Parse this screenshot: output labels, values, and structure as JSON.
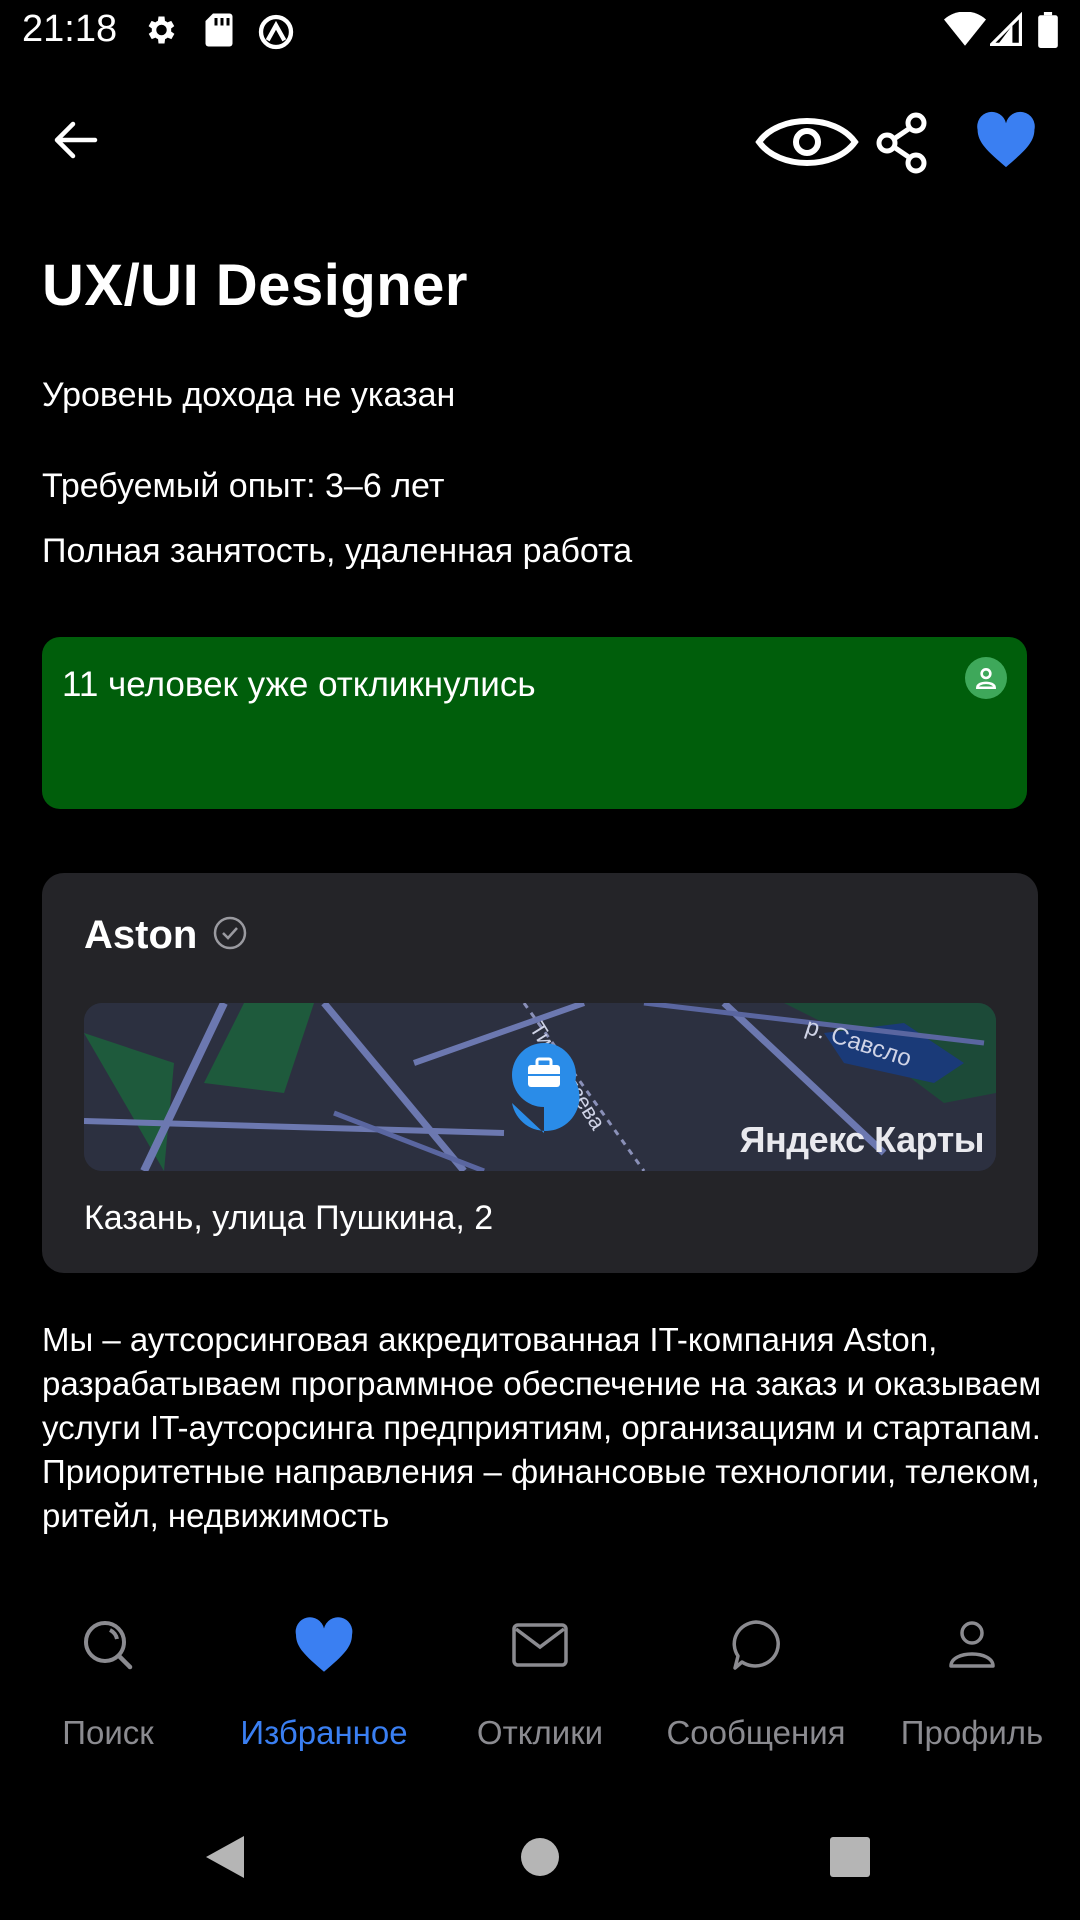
{
  "status_bar": {
    "time": "21:18"
  },
  "header": {
    "back_icon": "arrow-left-icon",
    "view_icon": "eye-icon",
    "share_icon": "share-icon",
    "favorite_icon": "heart-icon",
    "favorite_color": "#3a7ff2"
  },
  "vacancy": {
    "title": "UX/UI Designer",
    "salary": "Уровень дохода не указан",
    "experience": "Требуемый опыт: 3–6 лет",
    "employment": "Полная занятость, удаленная работа"
  },
  "banner": {
    "text": "11 человек уже откликнулись",
    "color": "#005e0b"
  },
  "company": {
    "name": "Aston",
    "map_label": "Яндекс Карты",
    "address": "Казань, улица Пушкина, 2"
  },
  "description": "Мы – аутсорсинговая аккредитованная IT-компания Aston, разрабатываем программное обеспечение на заказ и оказываем услуги IT-аутсорсинга предприятиям, организациям и стартапам. Приоритетные направления – финансовые технологии, телеком, ритейл, недвижимость",
  "nav": {
    "items": [
      {
        "label": "Поиск",
        "icon": "search-icon"
      },
      {
        "label": "Избранное",
        "icon": "heart-icon",
        "active": true
      },
      {
        "label": "Отклики",
        "icon": "envelope-icon"
      },
      {
        "label": "Сообщения",
        "icon": "chat-bubble-icon"
      },
      {
        "label": "Профиль",
        "icon": "person-icon"
      }
    ]
  }
}
